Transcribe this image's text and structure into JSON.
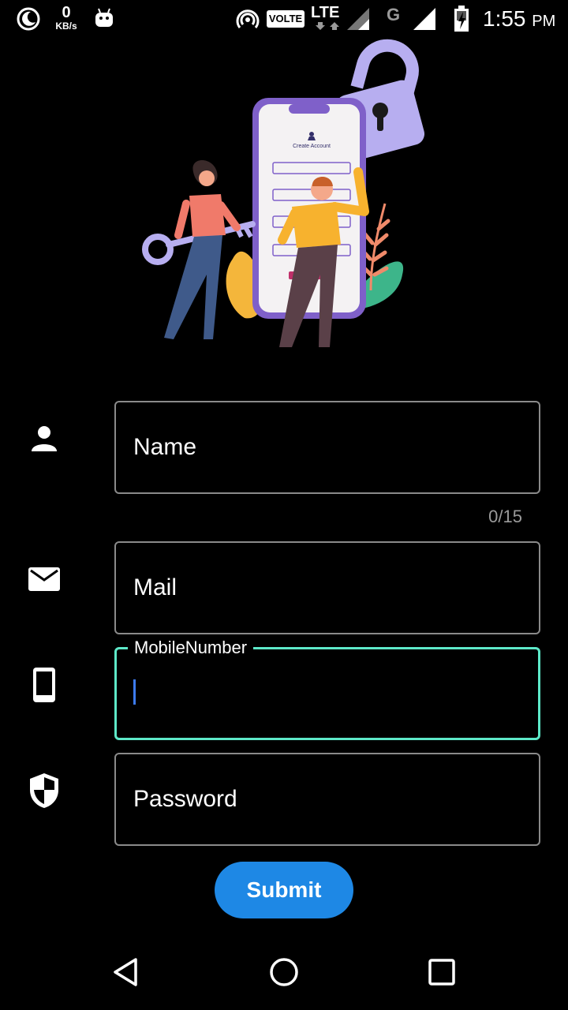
{
  "status_bar": {
    "speed_value": "0",
    "speed_unit": "KB/s",
    "volte": "VOLTE",
    "lte": "LTE",
    "g": "G",
    "time": "1:55",
    "ampm": "PM"
  },
  "illustration": {
    "screen_title": "Create Account"
  },
  "form": {
    "name": {
      "placeholder": "Name",
      "counter": "0/15",
      "icon": "person-icon"
    },
    "mail": {
      "placeholder": "Mail",
      "icon": "mail-icon"
    },
    "mobile": {
      "label": "MobileNumber",
      "value": "",
      "icon": "phone-icon"
    },
    "password": {
      "placeholder": "Password",
      "icon": "shield-icon"
    },
    "submit_label": "Submit",
    "focus_color": "#5de8c8",
    "button_color": "#1e88e5"
  },
  "nav_bar": {
    "back": "back-icon",
    "home": "home-icon",
    "recents": "recents-icon"
  }
}
